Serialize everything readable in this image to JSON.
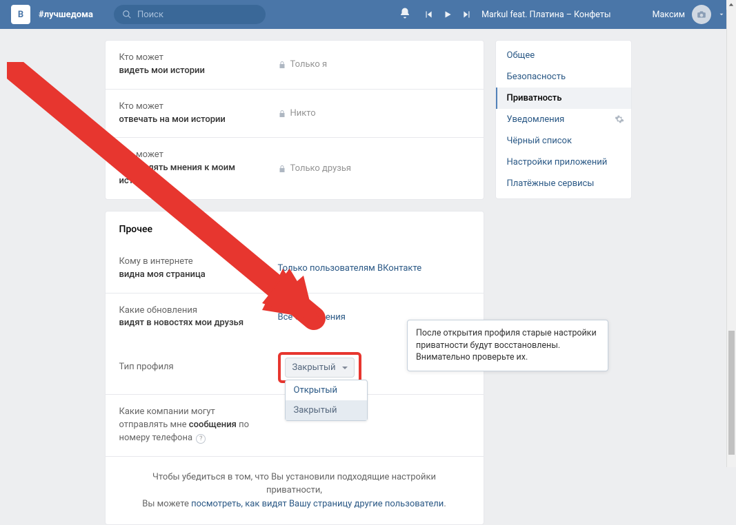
{
  "topbar": {
    "hashtag": "#лучшедома",
    "search_placeholder": "Поиск",
    "track": "Markul feat. Платина – Конфеты",
    "user_name": "Максим"
  },
  "settings_rows_1": [
    {
      "q": "Кто может",
      "b": "видеть мои истории",
      "val": "Только я",
      "locked": true
    },
    {
      "q": "Кто может",
      "b": "отвечать на мои истории",
      "val": "Никто",
      "locked": true
    },
    {
      "q": "Кто может",
      "b": "отправлять мнения к моим историям",
      "val": "Только друзья",
      "locked": true
    }
  ],
  "section2_title": "Прочее",
  "settings_rows_2": [
    {
      "q": "Кому в интернете",
      "b": "видна моя страница",
      "val": "Только пользователям ВКонтакте",
      "link": true
    },
    {
      "q": "Какие обновления",
      "b": "видят в новостях мои друзья",
      "val": "Все обновления",
      "link": true
    }
  ],
  "profile_type": {
    "label": "Тип профиля",
    "selected": "Закрытый",
    "options": [
      "Открытый",
      "Закрытый"
    ]
  },
  "companies_row": {
    "q": "Какие компании могут",
    "b1": "отправлять мне ",
    "b2": "сообщения",
    "b3": " по номеру телефона"
  },
  "tooltip": "После открытия профиля старые настройки приватности будут восстановлены. Внимательно проверьте их.",
  "footer": {
    "t1": "Чтобы убедиться в том, что Вы установили подходящие настройки приватности,",
    "t2": "Вы можете ",
    "link": "посмотреть, как видят Вашу страницу другие пользователи",
    "dot": "."
  },
  "sidebar": {
    "items": [
      {
        "label": "Общее",
        "active": false
      },
      {
        "label": "Безопасность",
        "active": false
      },
      {
        "label": "Приватность",
        "active": true
      },
      {
        "label": "Уведомления",
        "active": false,
        "gear": true
      },
      {
        "label": "Чёрный список",
        "active": false
      },
      {
        "label": "Настройки приложений",
        "active": false
      },
      {
        "label": "Платёжные сервисы",
        "active": false
      }
    ]
  }
}
